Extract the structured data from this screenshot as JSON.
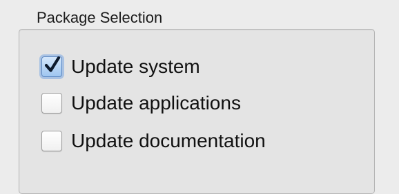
{
  "group": {
    "title": "Package Selection"
  },
  "options": [
    {
      "label": "Update system",
      "checked": true,
      "check_icon": "checkmark-icon"
    },
    {
      "label": "Update applications",
      "checked": false
    },
    {
      "label": "Update documentation",
      "checked": false
    }
  ],
  "colors": {
    "window_background": "#ececec",
    "group_background": "#e4e4e4",
    "checked_fill": "#9fc6f0",
    "focus_ring": "#78a5e1"
  }
}
